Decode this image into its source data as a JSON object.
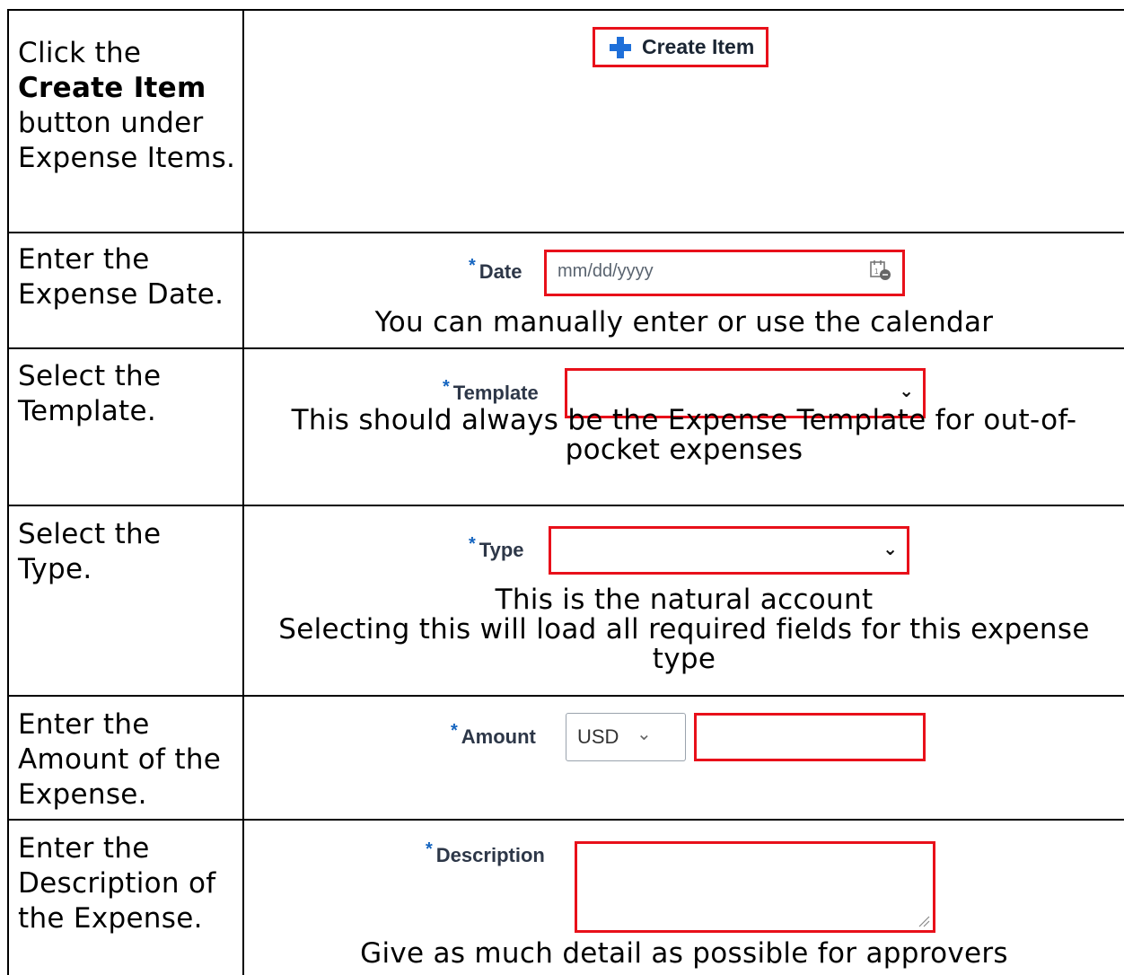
{
  "rows": [
    {
      "instruction": {
        "pre": "Click the",
        "bold": "Create Item",
        "post": "button under Expense Items."
      },
      "create_button_label": "Create Item"
    },
    {
      "instruction": "Enter the Expense Date.",
      "field_label": "Date",
      "placeholder": "mm/dd/yyyy",
      "note": "You can manually enter or use the calendar"
    },
    {
      "instruction": "Select the Template.",
      "field_label": "Template",
      "note_line1": "This should always be the Expense Template for out-of-",
      "note_line2": "pocket expenses"
    },
    {
      "instruction": "Select the Type.",
      "field_label": "Type",
      "note_line1": "This is the natural account",
      "note_line2": "Selecting this will load all required fields for this expense",
      "note_line3": "type"
    },
    {
      "instruction": "Enter the Amount of the Expense.",
      "field_label": "Amount",
      "currency": "USD"
    },
    {
      "instruction": "Enter the Description of the Expense.",
      "field_label": "Description",
      "note": "Give as much detail as possible for approvers"
    }
  ],
  "required_marker": "*",
  "colors": {
    "highlight": "#e8101a",
    "required": "#1565c0",
    "plus_icon": "#1e6fd9"
  }
}
